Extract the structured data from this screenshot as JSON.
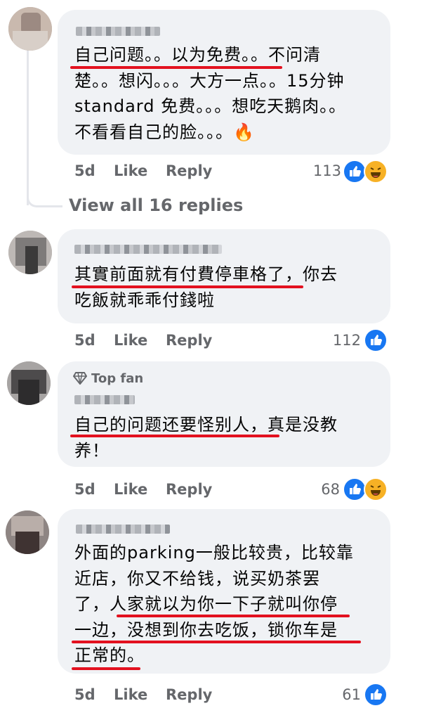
{
  "comments": [
    {
      "text_lines": [
        "自己问题。。以为免费。。不问清",
        "楚。。想闪。。。大方一点。。15分钟",
        "standard 免费。。。想吃天鹅肉。。",
        "不看看自己的脸。。。🔥"
      ],
      "time": "5d",
      "like_label": "Like",
      "reply_label": "Reply",
      "reaction_count": "113",
      "reactions": [
        "like-icon",
        "haha-icon"
      ]
    },
    {
      "text_lines": [
        "其實前面就有付費停車格了，你去",
        "吃飯就乖乖付錢啦"
      ],
      "time": "5d",
      "like_label": "Like",
      "reply_label": "Reply",
      "reaction_count": "112",
      "reactions": [
        "like-icon"
      ]
    },
    {
      "badge": "Top fan",
      "text_lines": [
        "自己的问题还要怪别人，真是没教",
        "养！"
      ],
      "time": "5d",
      "like_label": "Like",
      "reply_label": "Reply",
      "reaction_count": "68",
      "reactions": [
        "like-icon",
        "haha-icon"
      ]
    },
    {
      "text_lines": [
        "外面的parking一般比较贵，比较靠",
        "近店，你又不给钱，说买奶茶罢",
        "了，人家就以为你一下子就叫你停",
        "一边，没想到你去吃饭，锁你车是",
        "正常的。"
      ],
      "time": "5d",
      "like_label": "Like",
      "reply_label": "Reply",
      "reaction_count": "61",
      "reactions": [
        "like-icon"
      ]
    }
  ],
  "view_replies_label": "View all 16 replies",
  "colors": {
    "bubble": "#f0f2f5",
    "meta": "#65676b",
    "underline": "#e3111f",
    "like": "#1877f2",
    "haha": "#f7b125"
  }
}
